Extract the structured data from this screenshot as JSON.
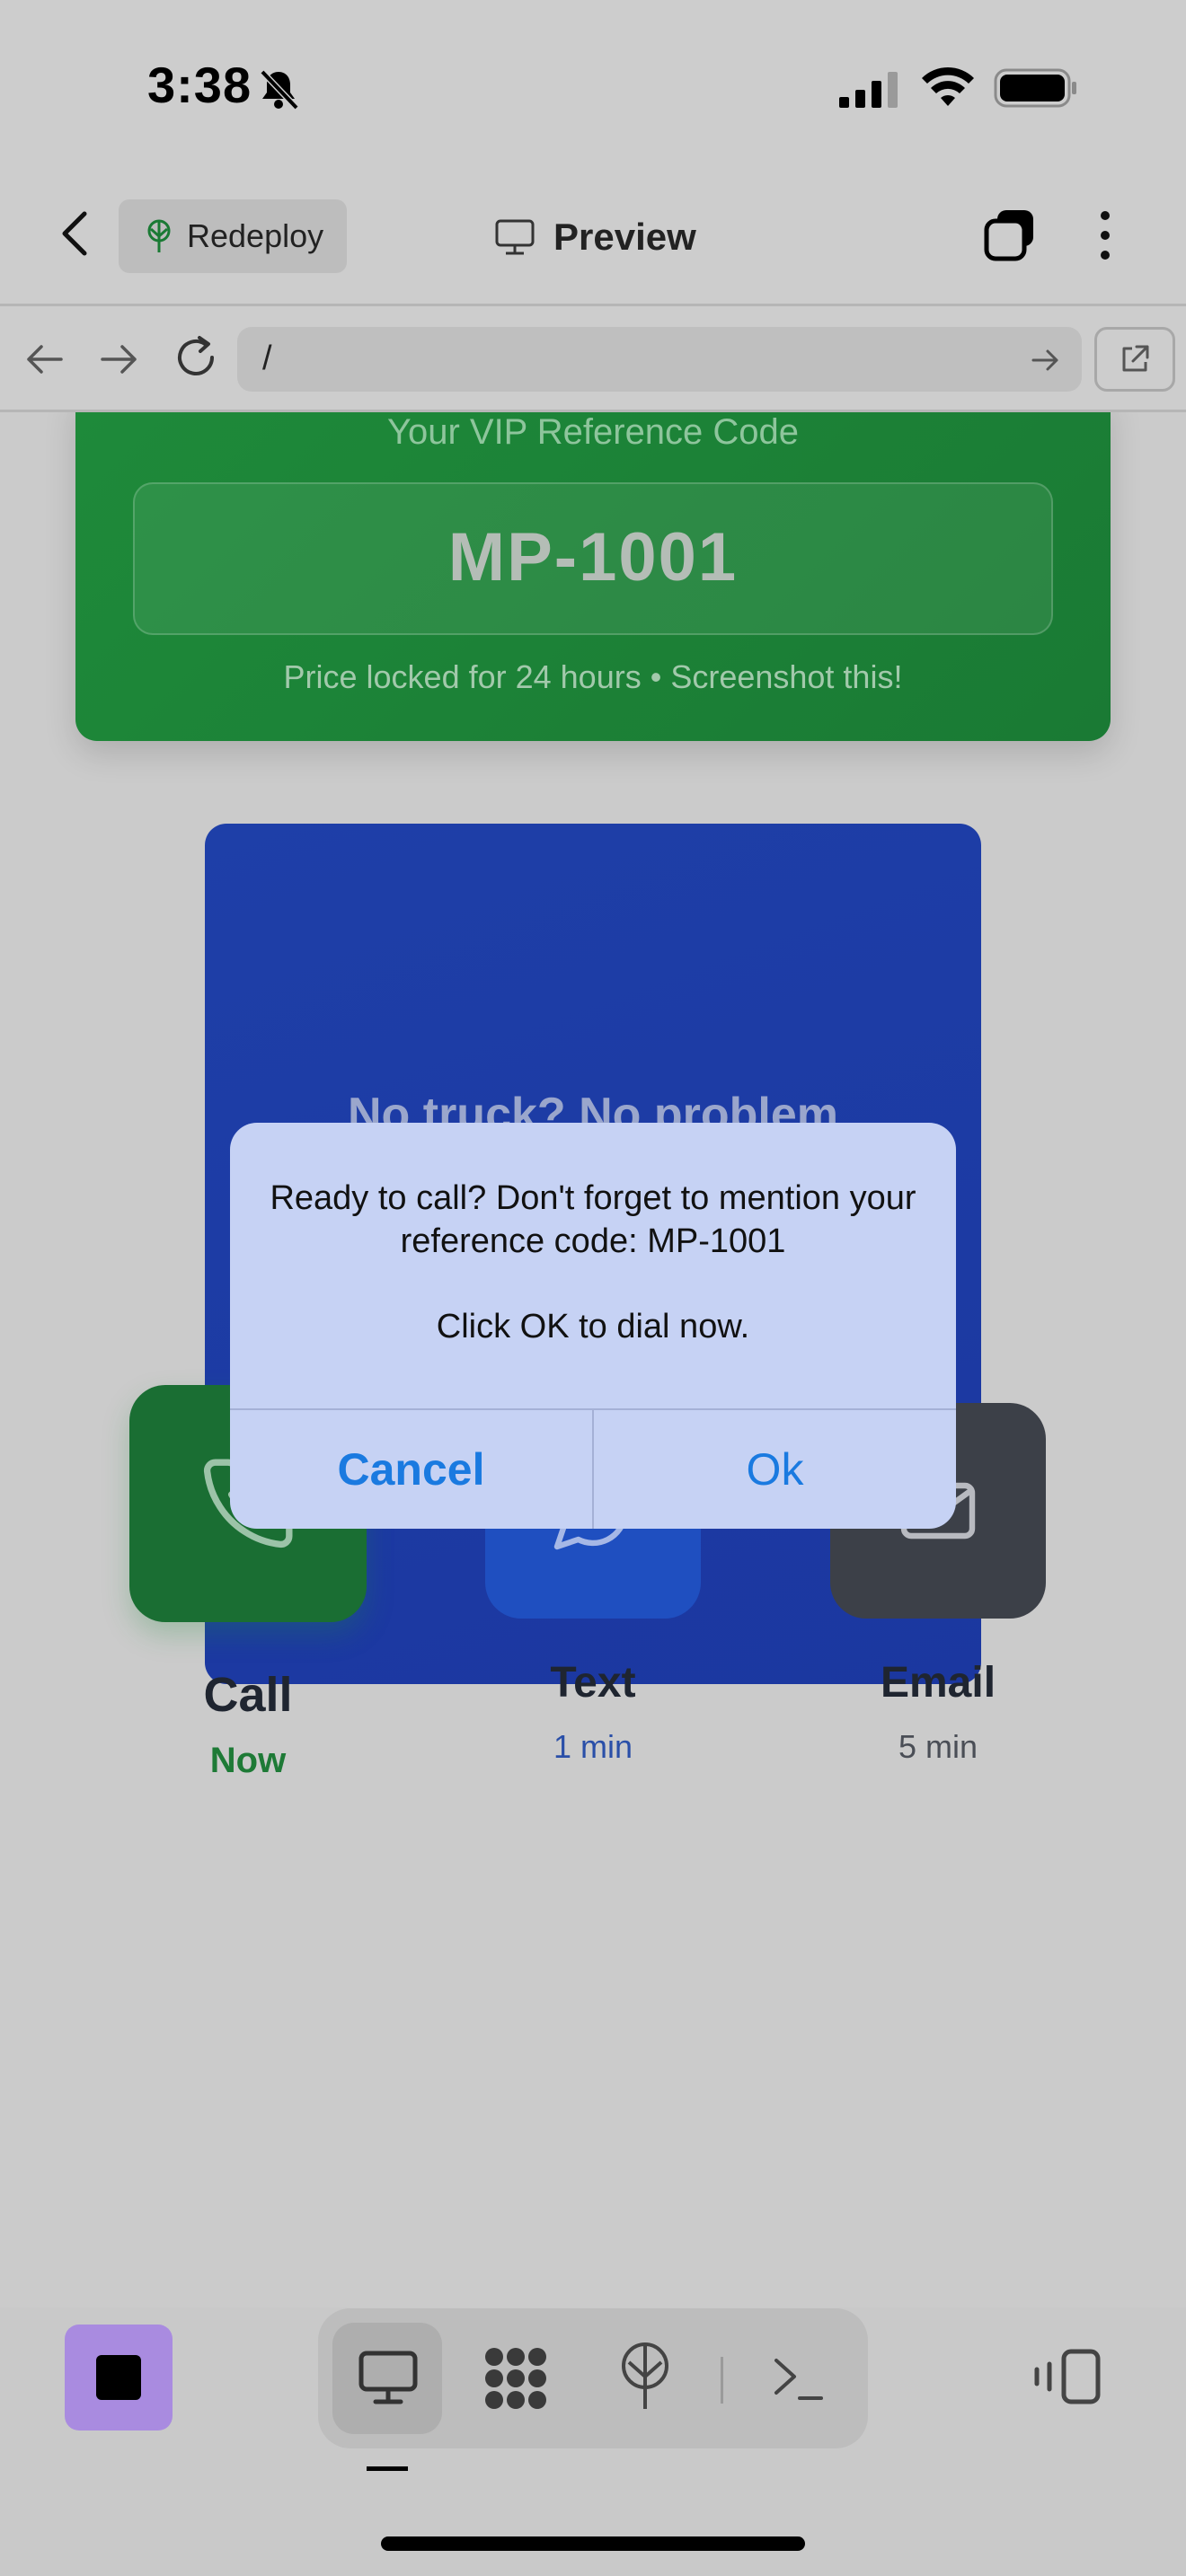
{
  "status_bar": {
    "time": "3:38",
    "icons": [
      "bell-slash-icon",
      "cellular-signal-icon",
      "wifi-icon",
      "battery-icon"
    ]
  },
  "header": {
    "redeploy_label": "Redeploy",
    "title": "Preview"
  },
  "url_bar": {
    "value": "/"
  },
  "vip_card": {
    "title": "Your VIP Reference Code",
    "code": "MP-1001",
    "note": "Price locked for 24 hours • Screenshot this!"
  },
  "promo_card": {
    "title": "No truck? No problem"
  },
  "dialog": {
    "message_line1": "Ready to call? Don't forget to mention your reference code: MP-1001",
    "message_line2": "Click OK to dial now.",
    "cancel_label": "Cancel",
    "ok_label": "Ok"
  },
  "actions": [
    {
      "label": "Call",
      "sub": "Now",
      "icon": "phone-icon",
      "color": "#1a6e33"
    },
    {
      "label": "Text",
      "sub": "1 min",
      "icon": "chat-bubble-icon",
      "color": "#1f4fc0"
    },
    {
      "label": "Email",
      "sub": "5 min",
      "icon": "envelope-icon",
      "color": "#3c4048"
    }
  ],
  "toolbar": {
    "icons": [
      "stop-icon",
      "desktop-icon",
      "dots-grid-icon",
      "deploy-icon",
      "terminal-icon",
      "panel-toggle-icon"
    ]
  },
  "colors": {
    "accent_green": "#1e8a3a",
    "accent_blue": "#1e3fa8",
    "dialog_button": "#1a7ae0",
    "stop_button": "#a98be0"
  }
}
